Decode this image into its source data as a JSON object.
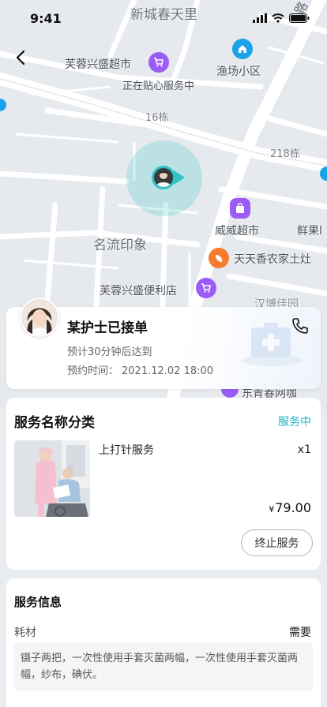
{
  "status_bar": {
    "time": "9:41"
  },
  "map": {
    "labels": {
      "xincheng": "新城春天里",
      "furong_supermarket": "芙蓉兴盛超市",
      "serving": "正在贴心服务中",
      "yuchang": "渔场小区",
      "building16": "16栋",
      "building218": "218栋",
      "mingliu": "名流印象",
      "weiwei": "威威超市",
      "xianguo": "鲜果l",
      "tiantian": "天天香农家土灶",
      "furong_store": "芙蓉兴盛便利店",
      "hanbo": "汉博佳园",
      "dongqing": "东青春网咖"
    }
  },
  "status_card": {
    "title": "某护士已接单",
    "eta": "预计30分钟后达到",
    "appt_label": "预约时间：",
    "appt_time": "2021.12.02 18:00"
  },
  "service_card": {
    "heading": "服务名称分类",
    "status": "服务中",
    "item_name": "上打针服务",
    "quantity": "x1",
    "currency": "¥",
    "price": "79.00",
    "stop_label": "终止服务"
  },
  "info_card": {
    "heading": "服务信息",
    "material_label": "耗材",
    "material_value": "需要",
    "material_note": "镊子两把，一次性使用手套灭菌两幅，一次性使用手套灭菌两幅，纱布，碘伏。"
  },
  "colors": {
    "accent": "#1fb6c8",
    "poi_purple": "#9b5cf6",
    "poi_orange": "#f47c2c",
    "poi_blue": "#1aa3e8"
  }
}
